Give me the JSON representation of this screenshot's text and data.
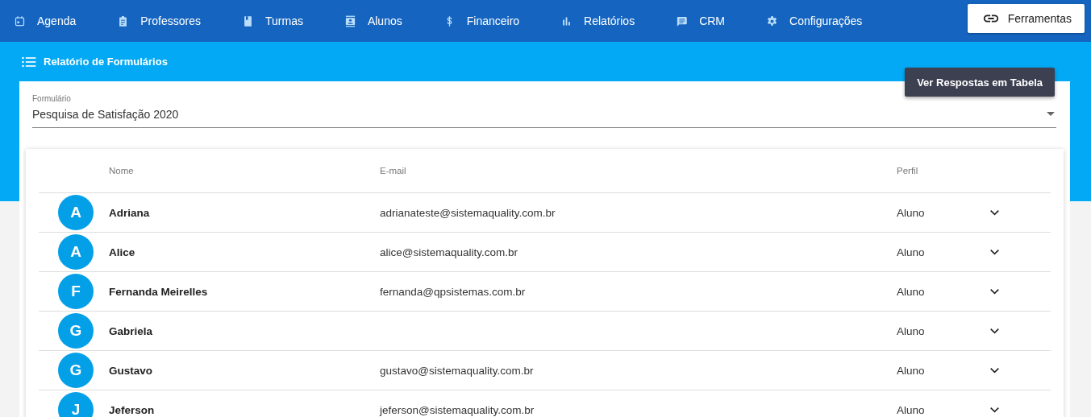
{
  "nav": {
    "items": [
      {
        "label": "Agenda"
      },
      {
        "label": "Professores"
      },
      {
        "label": "Turmas"
      },
      {
        "label": "Alunos"
      },
      {
        "label": "Financeiro"
      },
      {
        "label": "Relatórios"
      },
      {
        "label": "CRM"
      },
      {
        "label": "Configurações"
      }
    ],
    "tools_button": "Ferramentas"
  },
  "page_title": "Relatório de Formulários",
  "table_button": "Ver Respostas em Tabela",
  "form_select": {
    "label": "Formulário",
    "value": "Pesquisa de Satisfação 2020"
  },
  "table": {
    "columns": [
      "Nome",
      "E-mail",
      "Perfil"
    ],
    "rows": [
      {
        "initial": "A",
        "name": "Adriana",
        "email": "adrianateste@sistemaquality.com.br",
        "profile": "Aluno"
      },
      {
        "initial": "A",
        "name": "Alice",
        "email": "alice@sistemaquality.com.br",
        "profile": "Aluno"
      },
      {
        "initial": "F",
        "name": "Fernanda Meirelles",
        "email": "fernanda@qpsistemas.com.br",
        "profile": "Aluno"
      },
      {
        "initial": "G",
        "name": "Gabriela",
        "profile": "Aluno"
      },
      {
        "initial": "G",
        "name": "Gustavo",
        "email": "gustavo@sistemaquality.com.br",
        "profile": "Aluno"
      },
      {
        "initial": "J",
        "name": "Jeferson",
        "email": "jeferson@sistemaquality.com.br",
        "profile": "Aluno"
      }
    ]
  }
}
